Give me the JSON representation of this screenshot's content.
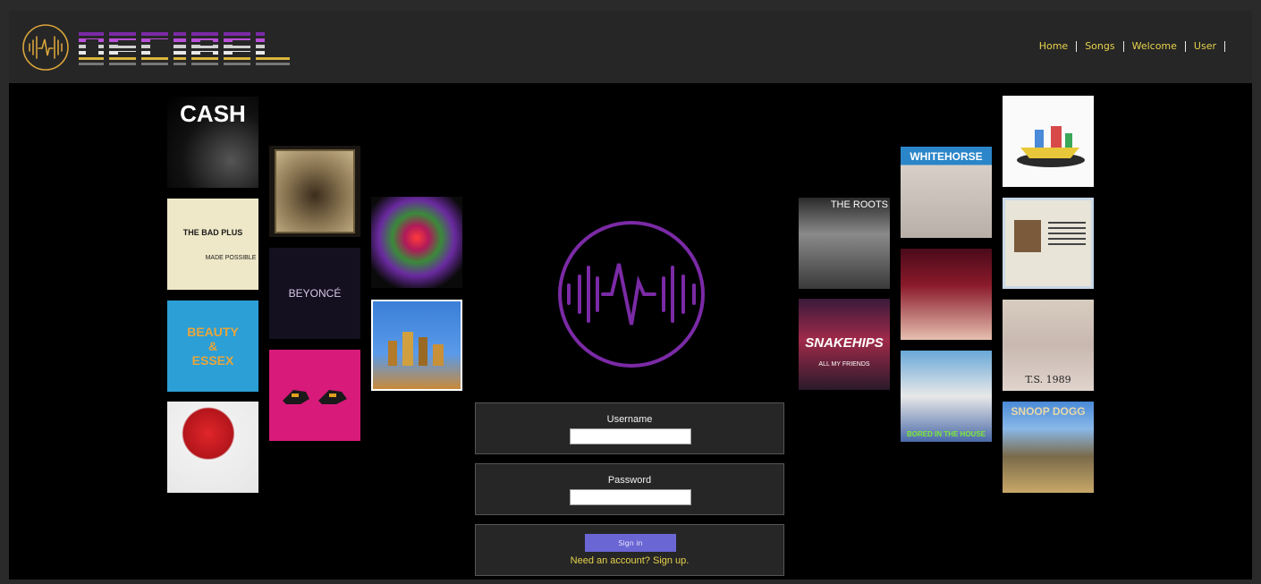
{
  "brand": {
    "name": "DECIBEL"
  },
  "nav": {
    "items": [
      "Home",
      "Songs",
      "Welcome",
      "User"
    ]
  },
  "colors": {
    "accent_yellow": "#e6d24b",
    "accent_purple": "#7b2aa6",
    "button_blue": "#6a66d4"
  },
  "albums": {
    "cash": "CASH",
    "bad_plus": "THE BAD PLUS",
    "bad_plus_sub": "MADE POSSIBLE",
    "beauty_essex": "BEAUTY & ESSEX",
    "beyonce": "BEYONCÉ",
    "roots": "THE ROOTS",
    "whitehorse": "WHITEHORSE",
    "snakehips": "SNAKEHIPS",
    "snakehips_sub": "ALL MY FRIENDS",
    "bored": "BORED IN THE HOUSE",
    "ts1989": "T.S.   1989",
    "snoop": "SNOOP DOGG"
  },
  "form": {
    "username_label": "Username",
    "password_label": "Password",
    "signin_label": "Sign in",
    "signup_text": "Need an account? Sign up."
  }
}
